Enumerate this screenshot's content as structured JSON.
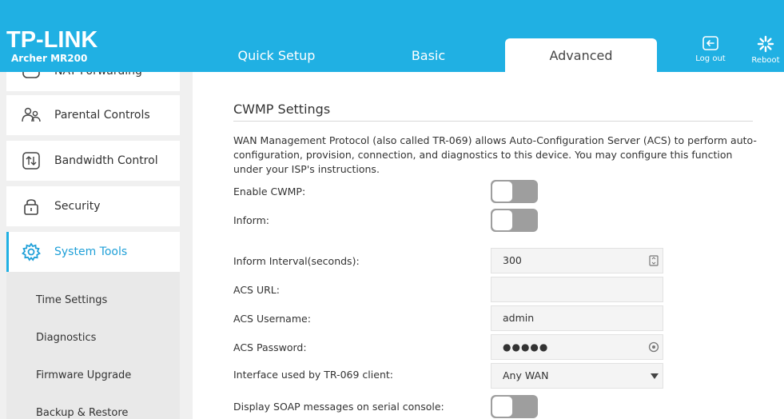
{
  "header": {
    "logo": "TP-LINK",
    "model": "Archer MR200",
    "tabs": [
      {
        "label": "Quick Setup"
      },
      {
        "label": "Basic"
      },
      {
        "label": "Advanced"
      }
    ],
    "logout_label": "Log out",
    "reboot_label": "Reboot",
    "brand_color": "#20b0e3"
  },
  "sidebar": {
    "items": [
      {
        "label": "NAT Forwarding",
        "icon": "nat-icon"
      },
      {
        "label": "Parental Controls",
        "icon": "parental-icon"
      },
      {
        "label": "Bandwidth Control",
        "icon": "bandwidth-icon"
      },
      {
        "label": "Security",
        "icon": "lock-icon"
      },
      {
        "label": "System Tools",
        "icon": "gear-icon",
        "active": true
      }
    ],
    "subitems": [
      {
        "label": "Time Settings"
      },
      {
        "label": "Diagnostics"
      },
      {
        "label": "Firmware Upgrade"
      },
      {
        "label": "Backup & Restore"
      }
    ]
  },
  "main": {
    "title": "CWMP Settings",
    "description": "WAN Management Protocol (also called TR-069) allows Auto-Configuration Server (ACS) to perform auto-configuration, provision, connection, and diagnostics to this device. You may configure this function under your ISP's instructions.",
    "fields": {
      "enable_cwmp": {
        "label": "Enable CWMP:",
        "on": false
      },
      "inform": {
        "label": "Inform:",
        "on": false
      },
      "inform_interval": {
        "label": "Inform Interval(seconds):",
        "value": "300"
      },
      "acs_url": {
        "label": "ACS URL:",
        "value": ""
      },
      "acs_username": {
        "label": "ACS Username:",
        "value": "admin"
      },
      "acs_password": {
        "label": "ACS Password:",
        "value": "●●●●●"
      },
      "interface": {
        "label": "Interface used by TR-069 client:",
        "value": "Any WAN"
      },
      "soap": {
        "label": "Display SOAP messages on serial console:",
        "on": false
      }
    }
  }
}
